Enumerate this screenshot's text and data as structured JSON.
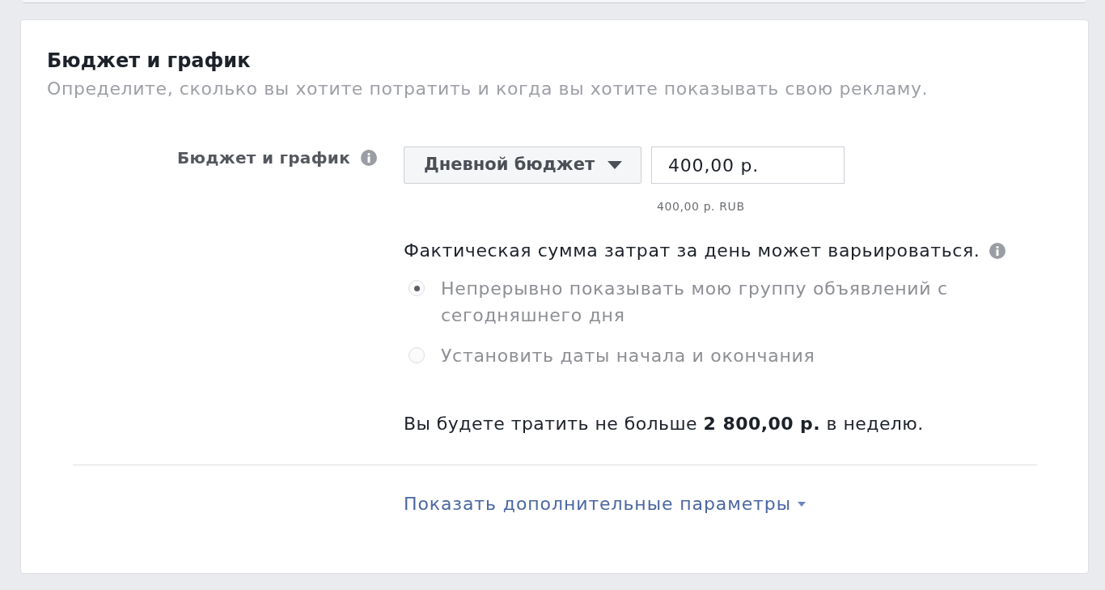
{
  "section": {
    "title": "Бюджет и график",
    "description": "Определите, сколько вы хотите потратить и когда вы хотите показывать свою рекламу."
  },
  "budget": {
    "label": "Бюджет и график",
    "type_dropdown": {
      "value": "Дневной бюджет"
    },
    "amount": {
      "value": "400,00 р."
    },
    "amount_hint": "400,00 р. RUB"
  },
  "schedule": {
    "note": "Фактическая сумма затрат за день может варьироваться.",
    "options": [
      {
        "label": "Непрерывно показывать мою группу объявлений с сегодняшнего дня",
        "selected": true
      },
      {
        "label": "Установить даты начала и окончания",
        "selected": false
      }
    ]
  },
  "summary": "Вы будете тратить не больше **2 800,00 р.** в неделю.",
  "more_link": "Показать дополнительные параметры"
}
